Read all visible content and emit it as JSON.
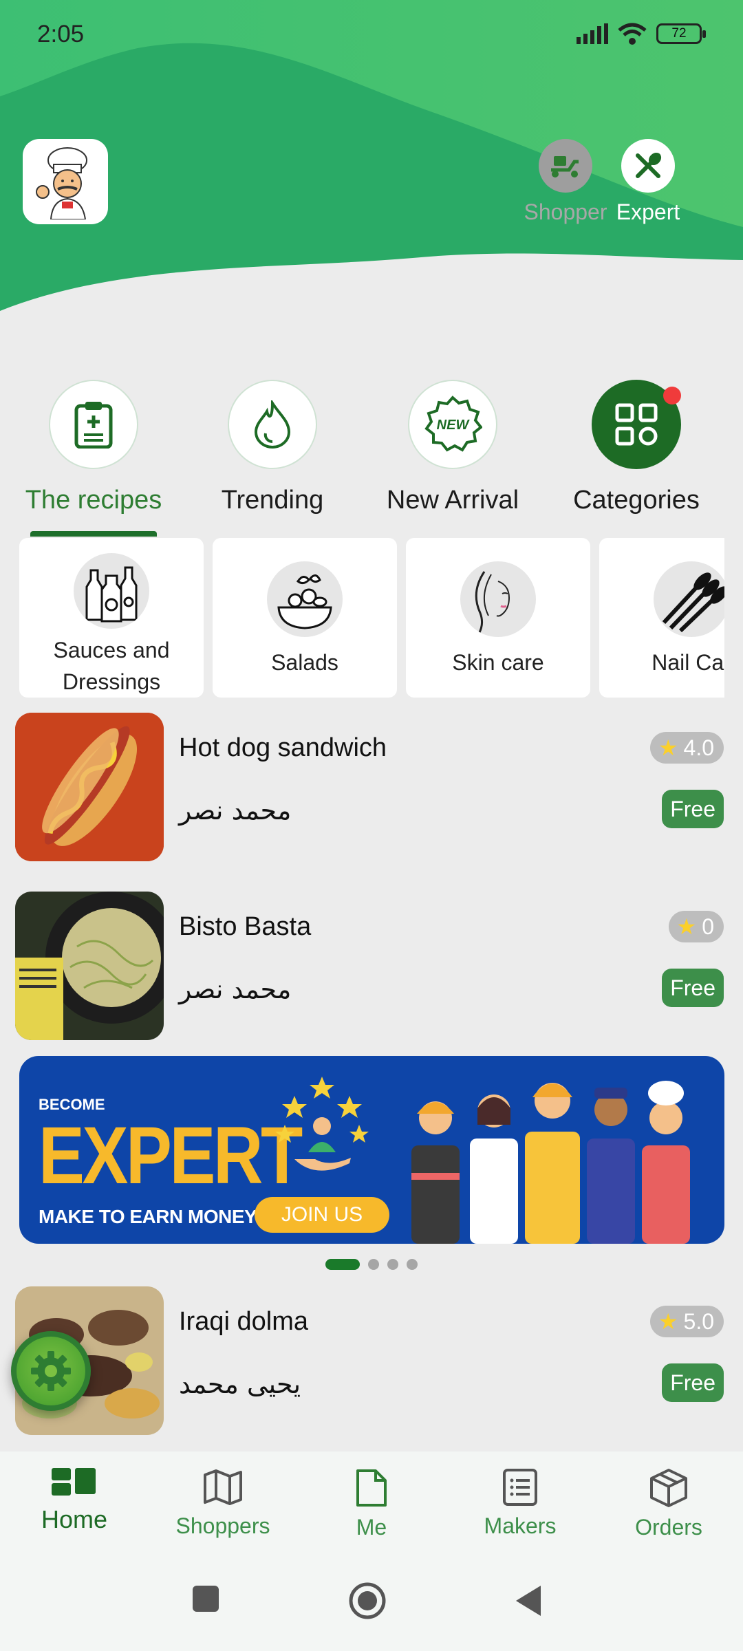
{
  "status_bar": {
    "time": "2:05",
    "battery": "72"
  },
  "header": {
    "roles": [
      {
        "label": "Shopper",
        "icon": "scooter-icon"
      },
      {
        "label": "Expert",
        "icon": "utensils-icon"
      }
    ]
  },
  "tabs": [
    {
      "label": "The recipes",
      "icon": "clipboard-icon",
      "active": true
    },
    {
      "label": "Trending",
      "icon": "flame-icon"
    },
    {
      "label": "New Arrival",
      "icon": "new-badge-icon",
      "badge_text": "NEW"
    },
    {
      "label": "Categories",
      "icon": "grid-icon",
      "has_notification": true
    }
  ],
  "categories": [
    {
      "label_line1": "Sauces and",
      "label_line2": "Dressings"
    },
    {
      "label": "Salads"
    },
    {
      "label": "Skin care"
    },
    {
      "label": "Nail Car"
    }
  ],
  "recipes": [
    {
      "title": "Hot dog sandwich",
      "author": "محمد نصر",
      "rating": "4.0",
      "price": "Free"
    },
    {
      "title": "Bisto Basta",
      "author": "محمد نصر",
      "rating": "0",
      "price": "Free"
    },
    {
      "title": "Iraqi dolma",
      "author": "يحيى محمد",
      "rating": "5.0",
      "price": "Free"
    }
  ],
  "banner": {
    "become": "BECOME",
    "expert": "EXPERT",
    "earn": "MAKE TO EARN MONEY !",
    "join": "JOIN US",
    "slides_total": 4,
    "slide_active": 1
  },
  "bottom_nav": [
    {
      "label": "Home",
      "icon": "dashboard-icon",
      "active": true
    },
    {
      "label": "Shoppers",
      "icon": "map-icon"
    },
    {
      "label": "Me",
      "icon": "file-icon"
    },
    {
      "label": "Makers",
      "icon": "list-icon"
    },
    {
      "label": "Orders",
      "icon": "box-icon"
    }
  ],
  "colors": {
    "primary": "#2e7d32",
    "header_green": "#33b46a",
    "accent_yellow": "#f7b92b",
    "notification": "#f03b3b"
  }
}
